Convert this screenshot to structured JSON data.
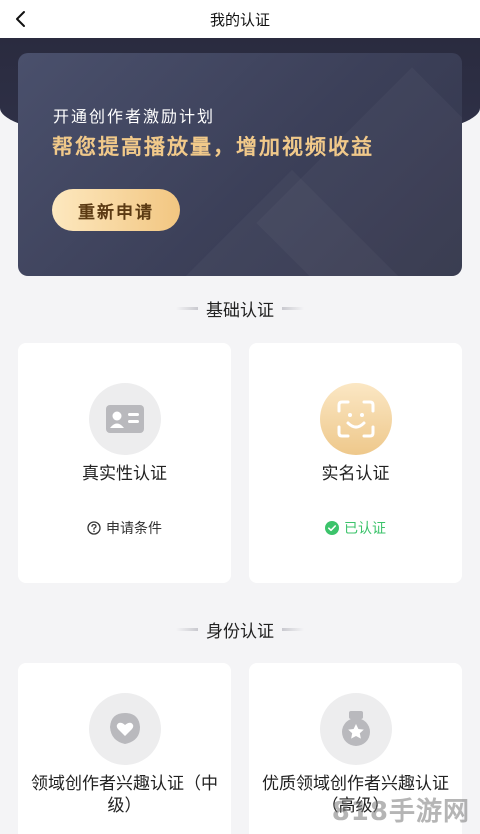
{
  "header": {
    "title": "我的认证",
    "back_icon": "chevron-left-icon"
  },
  "banner": {
    "subtitle": "开通创作者激励计划",
    "title": "帮您提高播放量，增加视频收益",
    "button_label": "重新申请",
    "accent_color": "#f1c98a"
  },
  "sections": [
    {
      "title": "基础认证",
      "cards": [
        {
          "label": "真实性认证",
          "icon": "id-card-icon",
          "note": "申请条件",
          "note_icon": "question-circle-icon",
          "note_color": "#333333"
        },
        {
          "label": "实名认证",
          "icon": "face-scan-icon",
          "note": "已认证",
          "note_icon": "check-circle-icon",
          "note_color": "#3cc36b"
        }
      ]
    },
    {
      "title": "身份认证",
      "cards": [
        {
          "label": "领域创作者兴趣认证（中级）",
          "icon": "heart-badge-icon"
        },
        {
          "label": "优质领域创作者兴趣认证（高级）",
          "icon": "star-medal-icon"
        }
      ]
    }
  ],
  "watermark": "818手游网"
}
